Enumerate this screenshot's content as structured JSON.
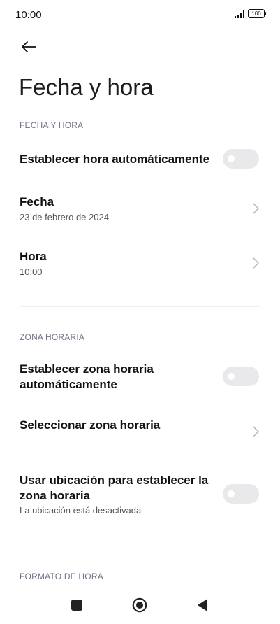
{
  "status_bar": {
    "time": "10:00",
    "battery": "100"
  },
  "header": {
    "title": "Fecha y hora"
  },
  "sections": {
    "date_time": {
      "header": "FECHA Y HORA",
      "auto_time": {
        "label": "Establecer hora automáticamente",
        "enabled": false
      },
      "date": {
        "label": "Fecha",
        "value": "23 de febrero de 2024"
      },
      "time": {
        "label": "Hora",
        "value": "10:00"
      }
    },
    "time_zone": {
      "header": "ZONA HORARIA",
      "auto_zone": {
        "label": "Establecer zona horaria automáticamente",
        "enabled": false
      },
      "select_zone": {
        "label": "Seleccionar zona horaria"
      },
      "use_location": {
        "label": "Usar ubicación para establecer la zona horaria",
        "sub": "La ubicación está desactivada",
        "enabled": false
      }
    },
    "time_format": {
      "header": "FORMATO DE HORA"
    }
  },
  "icons": {
    "back": "arrow-left-icon",
    "chevron": "chevron-right-icon",
    "signal": "signal-icon",
    "battery": "battery-icon",
    "nav_recents": "square-icon",
    "nav_home": "circle-icon",
    "nav_back": "triangle-left-icon"
  },
  "colors": {
    "section_header": "#6f7589",
    "toggle_off": "#e9e9ec",
    "divider": "#f0f0f2"
  }
}
